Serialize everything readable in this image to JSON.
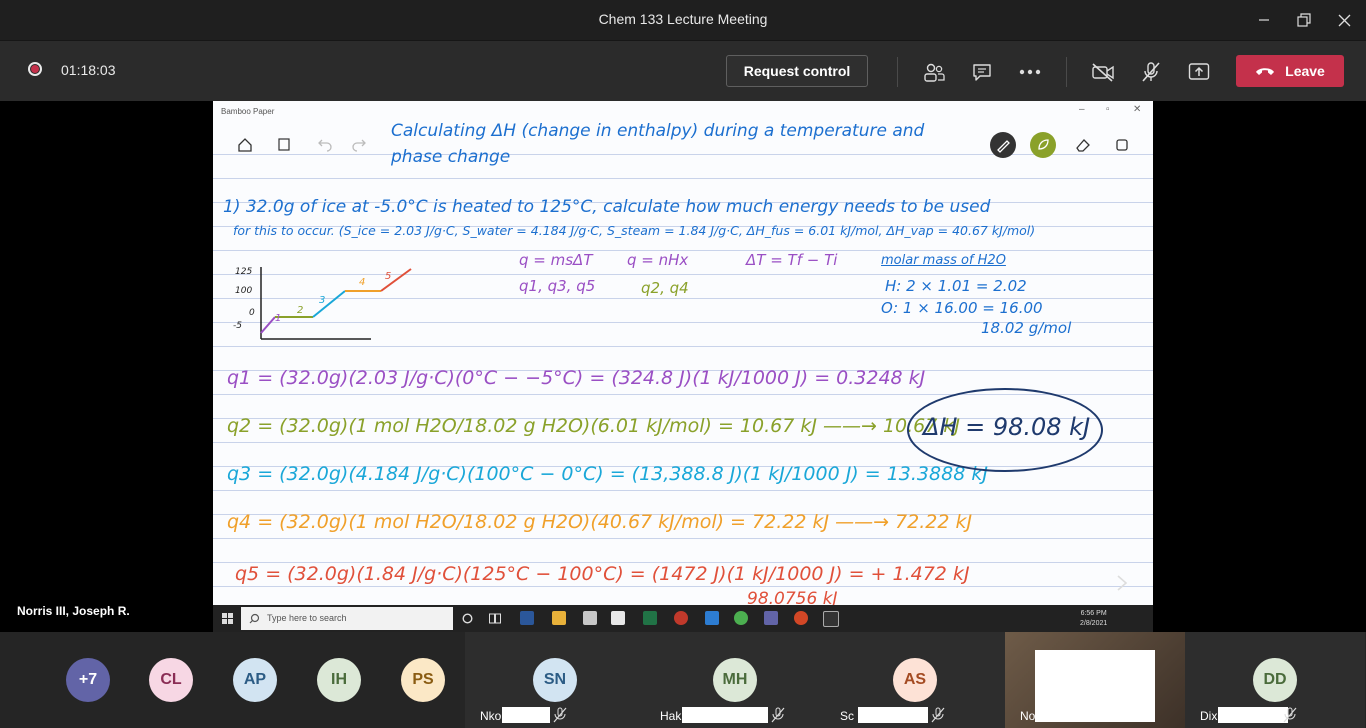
{
  "window": {
    "title": "Chem 133 Lecture Meeting"
  },
  "call": {
    "elapsed": "01:18:03",
    "request_control": "Request control",
    "leave": "Leave"
  },
  "share": {
    "app_label": "Bamboo Paper",
    "presenter": "Norris III, Joseph R.",
    "title_line1": "Calculating ΔH (change in enthalpy) during a temperature and",
    "title_line2": "phase change",
    "problem_line1": "1) 32.0g of ice at -5.0°C is heated to 125°C, calculate how much energy needs to be used",
    "problem_line2": "for this to occur. (S_ice = 2.03 J/g·C, S_water = 4.184 J/g·C, S_steam = 1.84 J/g·C, ΔH_fus = 6.01 kJ/mol, ΔH_vap = 40.67 kJ/mol)",
    "formulas": {
      "q_msdt": "q = msΔT",
      "q_nh": "q = nHx",
      "dt": "ΔT = Tf − Ti",
      "which_msdt": "q1, q3, q5",
      "which_nh": "q2, q4"
    },
    "molar_mass": {
      "heading": "molar mass of H2O",
      "h_line": "H: 2 × 1.01 = 2.02",
      "o_line": "O: 1 × 16.00 = 16.00",
      "total": "18.02 g/mol"
    },
    "graph": {
      "y_ticks": [
        "125",
        "100",
        "0",
        "-5"
      ],
      "segments": [
        "1",
        "2",
        "3",
        "4",
        "5"
      ]
    },
    "steps": {
      "q1": "q1 = (32.0g)(2.03 J/g·C)(0°C − −5°C) = (324.8 J)(1 kJ/1000 J) = 0.3248 kJ",
      "q2": "q2 = (32.0g)(1 mol H2O/18.02 g H2O)(6.01 kJ/mol) = 10.67 kJ ——→ 10.67 kJ",
      "q3": "q3 = (32.0g)(4.184 J/g·C)(100°C − 0°C) = (13,388.8 J)(1 kJ/1000 J) = 13.3888 kJ",
      "q4": "q4 = (32.0g)(1 mol H2O/18.02 g H2O)(40.67 kJ/mol) = 72.22 kJ ——→ 72.22 kJ",
      "q5": "q5 = (32.0g)(1.84 J/g·C)(125°C − 100°C) = (1472 J)(1 kJ/1000 J) = + 1.472 kJ",
      "sum": "98.0756 kJ"
    },
    "answer": "ΔH = 98.08 kJ",
    "taskbar": {
      "search_placeholder": "Type here to search",
      "time": "6:56 PM",
      "date": "2/8/2021"
    }
  },
  "participants": [
    {
      "initials": "+7",
      "bg": "#6264a7",
      "fg": "#ffffff"
    },
    {
      "initials": "CL",
      "bg": "#f7d7e4",
      "fg": "#8a2d55"
    },
    {
      "initials": "AP",
      "bg": "#d2e4f2",
      "fg": "#2c5c85"
    },
    {
      "initials": "IH",
      "bg": "#dce8d7",
      "fg": "#4a6b3b"
    },
    {
      "initials": "PS",
      "bg": "#fbe8c6",
      "fg": "#8a5c12"
    },
    {
      "initials": "SN",
      "bg": "#d2e4f2",
      "fg": "#2c5c85",
      "name": "Nko"
    },
    {
      "initials": "MH",
      "bg": "#dce8d7",
      "fg": "#4a6b3b",
      "name": "Hak"
    },
    {
      "initials": "AS",
      "bg": "#fde2d6",
      "fg": "#a44b22",
      "name": "Sc"
    },
    {
      "initials": "",
      "bg": "",
      "fg": "",
      "name": "No"
    },
    {
      "initials": "DD",
      "bg": "#dce8d7",
      "fg": "#4a6b3b",
      "name": "Dix"
    }
  ]
}
